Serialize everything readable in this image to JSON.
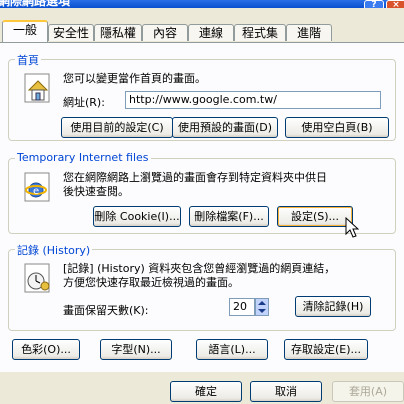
{
  "window": {
    "title": "網際網路選項",
    "help_button": "?",
    "close_button": "×"
  },
  "tabs": [
    "一般",
    "安全性",
    "隱私權",
    "內容",
    "連線",
    "程式集",
    "進階"
  ],
  "homepage": {
    "legend": "首頁",
    "description": "您可以變更當作首頁的畫面。",
    "address_label": "網址(R):",
    "address_value": "http://www.google.com.tw/",
    "use_current": "使用目前的設定(C)",
    "use_default": "使用預設的畫面(D)",
    "use_blank": "使用空白頁(B)"
  },
  "temp_files": {
    "legend": "Temporary Internet files",
    "description_line1": "您在網際網路上瀏覽過的畫面會存到特定資料夾中供日",
    "description_line2": "後快速查閱。",
    "delete_cookies": "刪除 Cookie(I)...",
    "delete_files": "刪除檔案(F)...",
    "settings": "設定(S)..."
  },
  "history": {
    "legend": "記錄 (History)",
    "description_line1": "[記錄] (History) 資料夾包含您曾經瀏覽過的網頁連結，",
    "description_line2": "方便您快速存取最近檢視過的畫面。",
    "days_label": "畫面保留天數(K):",
    "days_value": "20",
    "clear_history": "清除記錄(H)"
  },
  "bottom_buttons": {
    "colors": "色彩(O)...",
    "fonts": "字型(N)...",
    "languages": "語言(L)...",
    "accessibility": "存取設定(E)..."
  },
  "dialog_buttons": {
    "ok": "確定",
    "cancel": "取消",
    "apply": "套用(A)"
  }
}
